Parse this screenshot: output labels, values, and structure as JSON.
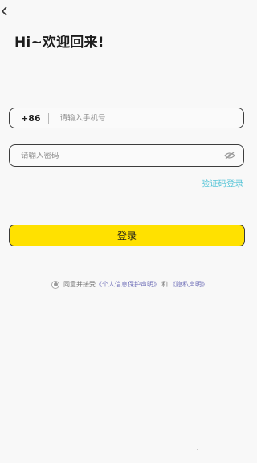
{
  "header": {
    "title": "Hi~欢迎回来!",
    "back_icon": "chevron-left-icon"
  },
  "form": {
    "country_code": "+86",
    "phone_placeholder": "请输入手机号",
    "password_placeholder": "请输入密码",
    "password_toggle_icon": "eye-slash-icon",
    "sms_login_link": "验证码登录",
    "login_button": "登录"
  },
  "agreement": {
    "prefix": "同意并接受",
    "privacy_policy": "《个人信息保护声明》",
    "and": "和",
    "privacy_statement": "《隐私声明》"
  },
  "colors": {
    "accent": "#FFE100",
    "link": "#5CC6D8",
    "policy_link": "#6F6FB8",
    "background": "#F8F8F8"
  }
}
